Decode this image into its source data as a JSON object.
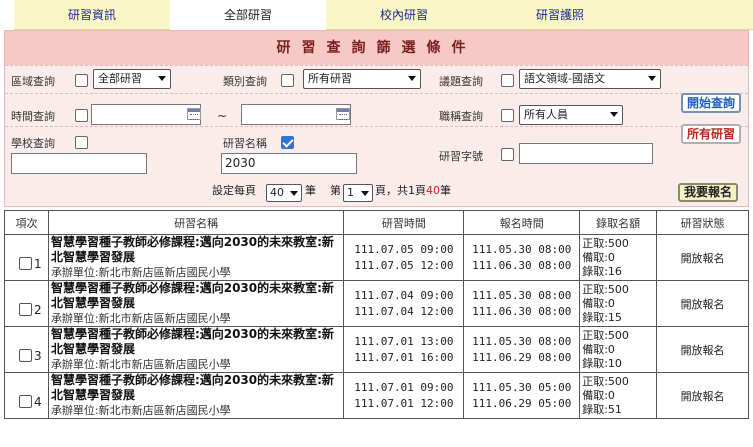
{
  "tabs": [
    {
      "label": "研習資訊"
    },
    {
      "label": "全部研習"
    },
    {
      "label": "校內研習"
    },
    {
      "label": "研習護照"
    }
  ],
  "panel": {
    "title": "研習查詢篩選條件",
    "region_label": "區域查詢",
    "region_value": "全部研習",
    "category_label": "類別查詢",
    "category_value": "所有研習",
    "topic_label": "議題查詢",
    "topic_value": "語文領域-國語文",
    "time_label": "時間查詢",
    "time_sep": "~",
    "title_role_label": "職稱查詢",
    "title_role_value": "所有人員",
    "school_label": "學校查詢",
    "course_name_label": "研習名稱",
    "course_name_value": "2030",
    "course_no_label": "研習字號",
    "search_button": "開始查詢",
    "all_button": "所有研習"
  },
  "paging": {
    "prefix": "設定每頁",
    "per_page": "40",
    "unit": "筆",
    "page_prefix": "第",
    "page": "1",
    "page_suffix": "頁，共",
    "total_pages": "1",
    "pages_word": "頁",
    "total_count": "40",
    "count_unit": "筆",
    "my_signup": "我要報名"
  },
  "table": {
    "headers": [
      "項次",
      "研習名稱",
      "研習時間",
      "報名時間",
      "錄取名額",
      "研習狀態"
    ],
    "rows": [
      {
        "no": "1",
        "title": "智慧學習種子教師必修課程:邁向2030的未來教室:新北智慧學習發展",
        "org": "承辦單位:新北市新店區新店國民小學",
        "study_start": "111.07.05 09:00",
        "study_end": "111.07.05 12:00",
        "reg_start": "111.05.30 08:00",
        "reg_end": "111.06.30 08:00",
        "quota": "正取:500",
        "wait": "備取:0",
        "admitted": "錄取:16",
        "state": "開放報名"
      },
      {
        "no": "2",
        "title": "智慧學習種子教師必修課程:邁向2030的未來教室:新北智慧學習發展",
        "org": "承辦單位:新北市新店區新店國民小學",
        "study_start": "111.07.04 09:00",
        "study_end": "111.07.04 12:00",
        "reg_start": "111.05.30 08:00",
        "reg_end": "111.06.30 08:00",
        "quota": "正取:500",
        "wait": "備取:0",
        "admitted": "錄取:15",
        "state": "開放報名"
      },
      {
        "no": "3",
        "title": "智慧學習種子教師必修課程:邁向2030的未來教室:新北智慧學習發展",
        "org": "承辦單位:新北市新店區新店國民小學",
        "study_start": "111.07.01 13:00",
        "study_end": "111.07.01 16:00",
        "reg_start": "111.05.30 08:00",
        "reg_end": "111.06.29 08:00",
        "quota": "正取:500",
        "wait": "備取:0",
        "admitted": "錄取:10",
        "state": "開放報名"
      },
      {
        "no": "4",
        "title": "智慧學習種子教師必修課程:邁向2030的未來教室:新北智慧學習發展",
        "org": "承辦單位:新北市新店區新店國民小學",
        "study_start": "111.07.01 09:00",
        "study_end": "111.07.01 12:00",
        "reg_start": "111.05.30 05:00",
        "reg_end": "111.06.29 05:00",
        "quota": "正取:500",
        "wait": "備取:0",
        "admitted": "錄取:51",
        "state": "開放報名"
      }
    ]
  }
}
